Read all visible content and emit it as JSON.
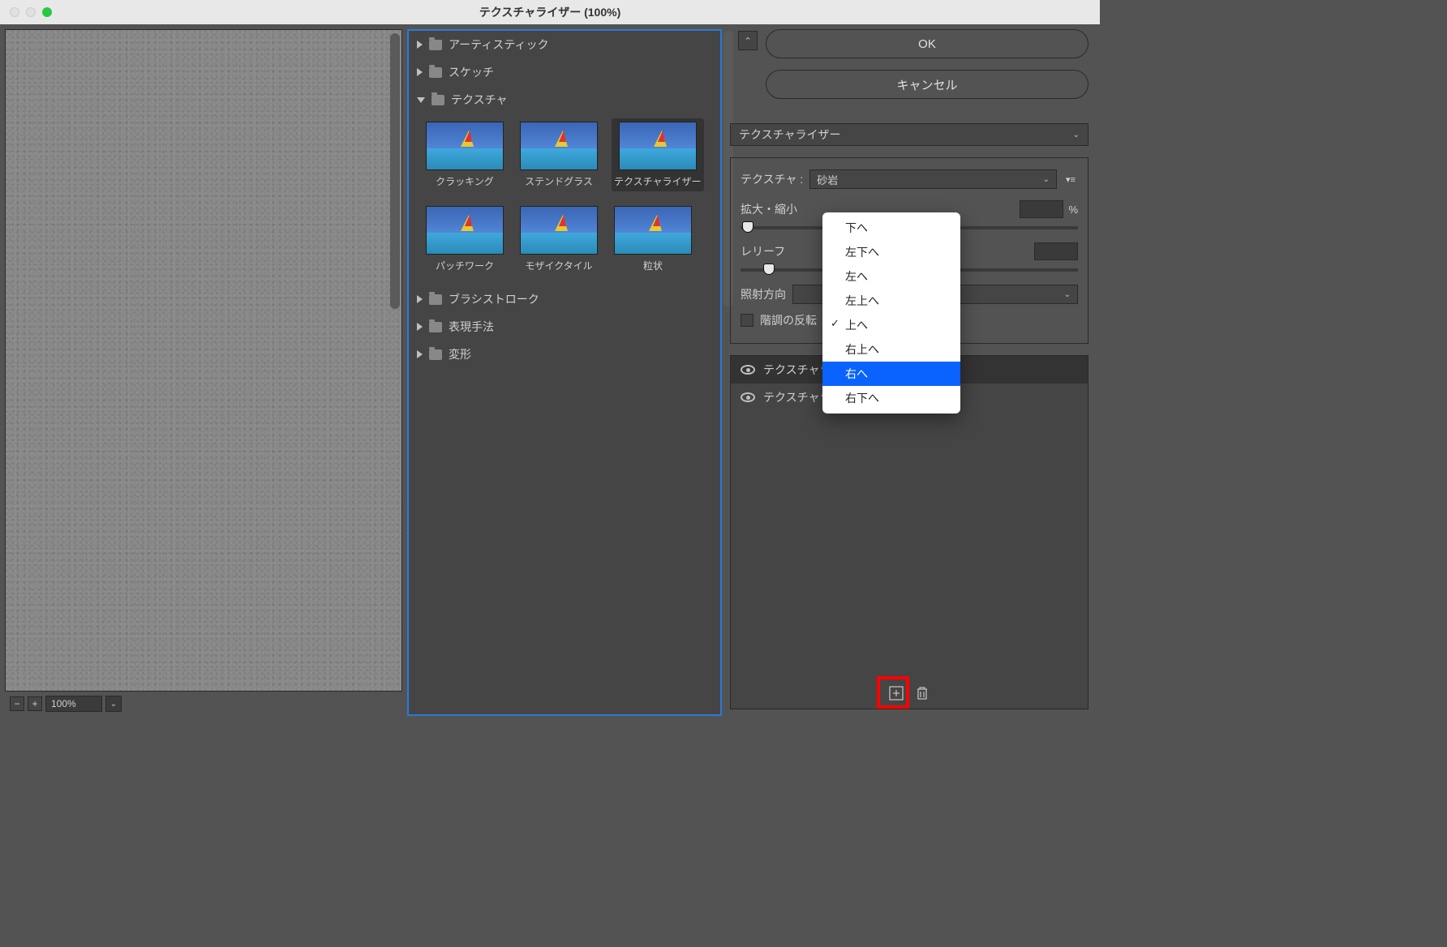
{
  "window": {
    "title": "テクスチャライザー (100%)"
  },
  "preview": {
    "zoom": "100%"
  },
  "browser": {
    "categories": [
      {
        "name": "アーティスティック",
        "open": false
      },
      {
        "name": "スケッチ",
        "open": false
      },
      {
        "name": "テクスチャ",
        "open": true
      },
      {
        "name": "ブラシストローク",
        "open": false
      },
      {
        "name": "表現手法",
        "open": false
      },
      {
        "name": "変形",
        "open": false
      }
    ],
    "texture_thumbs": [
      {
        "label": "クラッキング"
      },
      {
        "label": "ステンドグラス"
      },
      {
        "label": "テクスチャライザー"
      },
      {
        "label": "パッチワーク"
      },
      {
        "label": "モザイクタイル"
      },
      {
        "label": "粒状"
      }
    ],
    "selected_thumb": "テクスチャライザー"
  },
  "buttons": {
    "ok": "OK",
    "cancel": "キャンセル"
  },
  "filter_select": {
    "value": "テクスチャライザー"
  },
  "params": {
    "texture_label": "テクスチャ :",
    "texture_value": "砂岩",
    "scale_label": "拡大・縮小",
    "scale_unit": "%",
    "relief_label": "レリーフ",
    "light_label": "照射方向",
    "invert_label": "階調の反転"
  },
  "light_menu": {
    "items": [
      "下へ",
      "左下へ",
      "左へ",
      "左上へ",
      "上へ",
      "右上へ",
      "右へ",
      "右下へ"
    ],
    "checked": "上へ",
    "highlighted": "右へ"
  },
  "layers": {
    "items": [
      {
        "label": "テクスチャライザー",
        "selected": true
      },
      {
        "label": "テクスチャライザー",
        "selected": false
      }
    ]
  }
}
